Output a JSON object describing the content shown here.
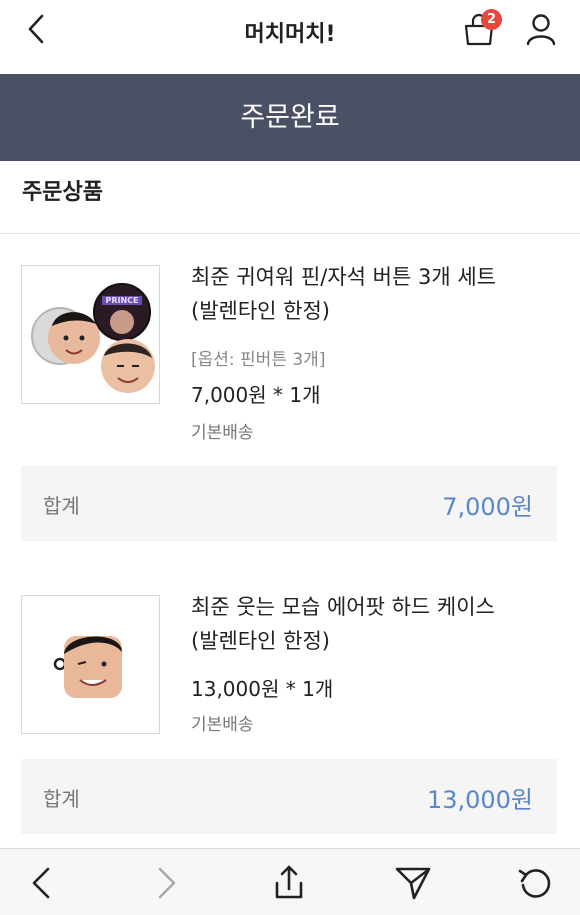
{
  "header": {
    "title": "머치머치!",
    "cart_count": "2"
  },
  "banner": {
    "title": "주문완료"
  },
  "section": {
    "title": "주문상품"
  },
  "items": [
    {
      "name_line1": "최준 귀여워 핀/자석 버튼 3개 세트",
      "name_line2": "(발렌타인 한정)",
      "option": "[옵션: 핀버튼 3개]",
      "price": "7,000원 * 1개",
      "shipping": "기본배송",
      "sum_label": "합계",
      "sum_amount": "7,000원",
      "badge_text": "PRINCE"
    },
    {
      "name_line1": "최준 웃는 모습 에어팟 하드 케이스",
      "name_line2": "(발렌타인 한정)",
      "price": "13,000원 * 1개",
      "shipping": "기본배송",
      "sum_label": "합계",
      "sum_amount": "13,000원"
    }
  ],
  "colors": {
    "banner": "#4b5165",
    "accent_price": "#5b86c9",
    "badge": "#e8453c"
  },
  "icons": {
    "back": "chevron-left-icon",
    "cart": "shopping-bag-icon",
    "user": "user-icon",
    "nav_back": "chevron-left-icon",
    "nav_forward": "chevron-right-icon",
    "share": "share-icon",
    "send": "send-icon",
    "reload": "reload-icon"
  }
}
